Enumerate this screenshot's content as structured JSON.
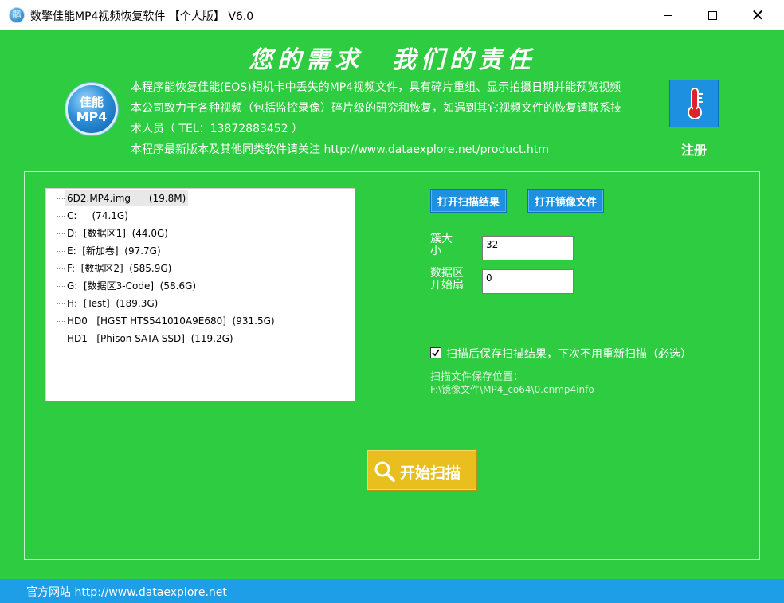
{
  "window": {
    "title": "数擎佳能MP4视频恢复软件 【个人版】 V6.0",
    "icon_text": "佳能MP4",
    "controls": {
      "minimize": "",
      "maximize": "",
      "close": "✕"
    }
  },
  "header": {
    "slogan": "您的需求　我们的责任",
    "logo": {
      "line1": "佳能",
      "line2": "MP4"
    },
    "info_lines": [
      "本程序能恢复佳能(EOS)相机卡中丢失的MP4视频文件，具有碎片重组、显示拍摄日期并能预览视频",
      "本公司致力于各种视频（包括监控录像）碎片级的研究和恢复，如遇到其它视频文件的恢复请联系技",
      "术人员（ TEL：13872883452 ）",
      "本程序最新版本及其他同类软件请关注 http://www.dataexplore.net/product.htm"
    ],
    "register_label": "注册",
    "register_icon": "thermometer-key-icon"
  },
  "drive_tree": {
    "items": [
      {
        "name": "6D2.MP4.img",
        "size": "(19.8M)"
      },
      {
        "name": "C:",
        "size": "(74.1G)"
      },
      {
        "name": "D:  [数据区1]",
        "size": "(44.0G)"
      },
      {
        "name": "E:  [新加卷]",
        "size": "(97.7G)"
      },
      {
        "name": "F:  [数据区2]",
        "size": "(585.9G)"
      },
      {
        "name": "G:  [数据区3-Code]",
        "size": "(58.6G)"
      },
      {
        "name": "H:  [Test]",
        "size": "(189.3G)"
      },
      {
        "name": "HD0   [HGST HTS541010A9E680]",
        "size": "(931.5G)"
      },
      {
        "name": "HD1   [Phison SATA SSD]",
        "size": "(119.2G)"
      }
    ],
    "selected_index": 0
  },
  "controls": {
    "open_scan_result": "打开扫描结果",
    "open_image_file": "打开镜像文件",
    "cluster_label_line1": "簇大",
    "cluster_label_line2": "小",
    "cluster_value": "32",
    "data_start_label_line1": "数据区",
    "data_start_label_line2": "开始扇",
    "data_start_value": "0",
    "save_checkbox_checked": true,
    "save_checkbox_label": "扫描后保存扫描结果，下次不用重新扫描（必选）",
    "save_location_title": "扫描文件保存位置：",
    "save_location_path": "F:\\镜像文件\\MP4_co64\\0.cnmp4info",
    "start_scan": "开始扫描"
  },
  "footer": {
    "label": "官方网站 http://www.dataexplore.net"
  },
  "colors": {
    "background": "#2ecc40",
    "button_blue": "#1e90e0",
    "scan_button": "#e8bf1e",
    "footer": "#1e9ee6"
  }
}
